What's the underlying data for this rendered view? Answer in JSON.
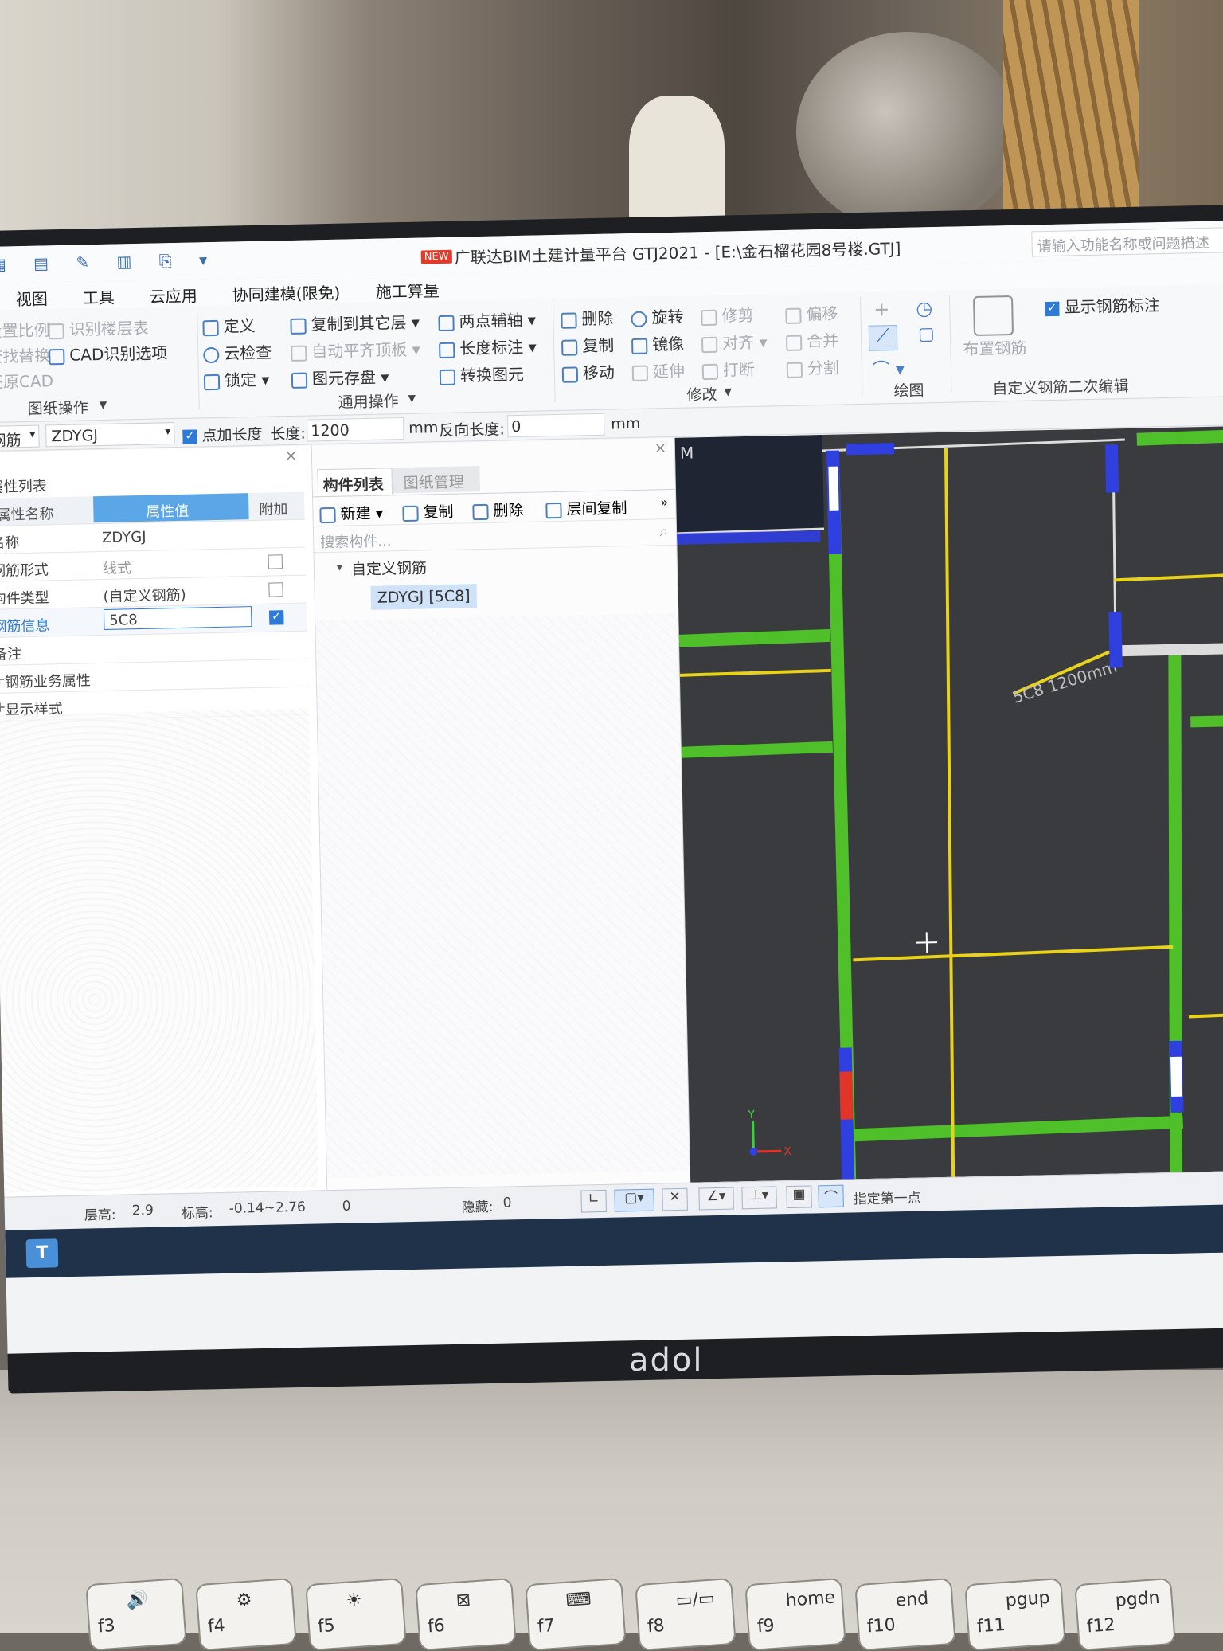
{
  "window": {
    "title_badge": "NEW",
    "title": "广联达BIM土建计量平台 GTJ2021 - [E:\\金石榴花园8号楼.GTJ]",
    "search_placeholder": "请输入功能名称或问题描述"
  },
  "menu": [
    "视图",
    "工具",
    "云应用",
    "协同建模(限免)",
    "施工算量"
  ],
  "ribbon": {
    "drawing_ops": {
      "items": [
        "设置比例",
        "识别楼层表",
        "查找替换",
        "CAD识别选项",
        "还原CAD"
      ],
      "group_label": "图纸操作"
    },
    "general_ops": {
      "items": [
        "定义",
        "复制到其它层",
        "两点辅轴",
        "云检查",
        "自动平齐顶板",
        "长度标注",
        "锁定",
        "图元存盘",
        "转换图元"
      ],
      "group_label": "通用操作"
    },
    "modify": {
      "items": [
        "删除",
        "旋转",
        "修剪",
        "偏移",
        "复制",
        "镜像",
        "对齐",
        "合并",
        "移动",
        "延伸",
        "打断",
        "分割"
      ],
      "group_label": "修改"
    },
    "draw": {
      "group_label": "绘图"
    },
    "custom_rebar": {
      "show_label": "显示钢筋标注",
      "place_label": "布置钢筋",
      "group_label": "自定义钢筋二次编辑"
    }
  },
  "option_bar": {
    "type_value": "钢筋",
    "name_value": "ZDYGJ",
    "point_length_label": "点加长度",
    "length_label": "长度:",
    "length_value": "1200",
    "unit1": "mm",
    "reverse_label": "反向长度:",
    "reverse_value": "0",
    "unit2": "mm"
  },
  "properties": {
    "panel_title": "属性列表",
    "columns": [
      "属性名称",
      "属性值",
      "附加"
    ],
    "rows": [
      {
        "name": "名称",
        "value": "ZDYGJ",
        "check": null
      },
      {
        "name": "钢筋形式",
        "value": "线式",
        "check": false
      },
      {
        "name": "构件类型",
        "value": "(自定义钢筋)",
        "check": false
      },
      {
        "name": "钢筋信息",
        "value": "5C8",
        "check": true
      },
      {
        "name": "备注",
        "value": "",
        "check": null
      },
      {
        "name": "钢筋业务属性",
        "value": "",
        "check": null
      },
      {
        "name": "显示样式",
        "value": "",
        "check": null
      }
    ]
  },
  "component_list": {
    "tabs": [
      "构件列表",
      "图纸管理"
    ],
    "actions": [
      "新建",
      "复制",
      "删除",
      "层间复制"
    ],
    "search_placeholder": "搜索构件...",
    "tree_root": "自定义钢筋",
    "tree_item": "ZDYGJ [5C8]"
  },
  "canvas": {
    "corner_label": "M",
    "rebar_annotation": "5C8 1200mm",
    "axis_y": "Y",
    "axis_x": "X"
  },
  "status": {
    "floor_height_label": "层高:",
    "floor_height": "2.9",
    "elevation_label": "标高:",
    "elevation": "-0.14~2.76",
    "count": "0",
    "hidden_label": "隐藏:",
    "hidden": "0",
    "prompt": "指定第一点"
  },
  "laptop": {
    "brand": "adol"
  },
  "keys": [
    {
      "fn": "f3",
      "sym": "🔊"
    },
    {
      "fn": "f4",
      "sym": "⚙"
    },
    {
      "fn": "f5",
      "sym": "☀"
    },
    {
      "fn": "f6",
      "sym": "⊠"
    },
    {
      "fn": "f7",
      "sym": "⌨"
    },
    {
      "fn": "f8",
      "sym": "▭/▭"
    },
    {
      "fn": "f9",
      "sym": "home"
    },
    {
      "fn": "f10",
      "sym": "end"
    },
    {
      "fn": "f11",
      "sym": "pgup"
    },
    {
      "fn": "f12",
      "sym": "pgdn"
    }
  ],
  "colors": {
    "wall_green": "#4fbf2a",
    "beam_yellow": "#e9d21a",
    "column_blue": "#2f3fe0",
    "accent_blue": "#2f7ad6",
    "canvas_bg": "#3a3b3e"
  }
}
